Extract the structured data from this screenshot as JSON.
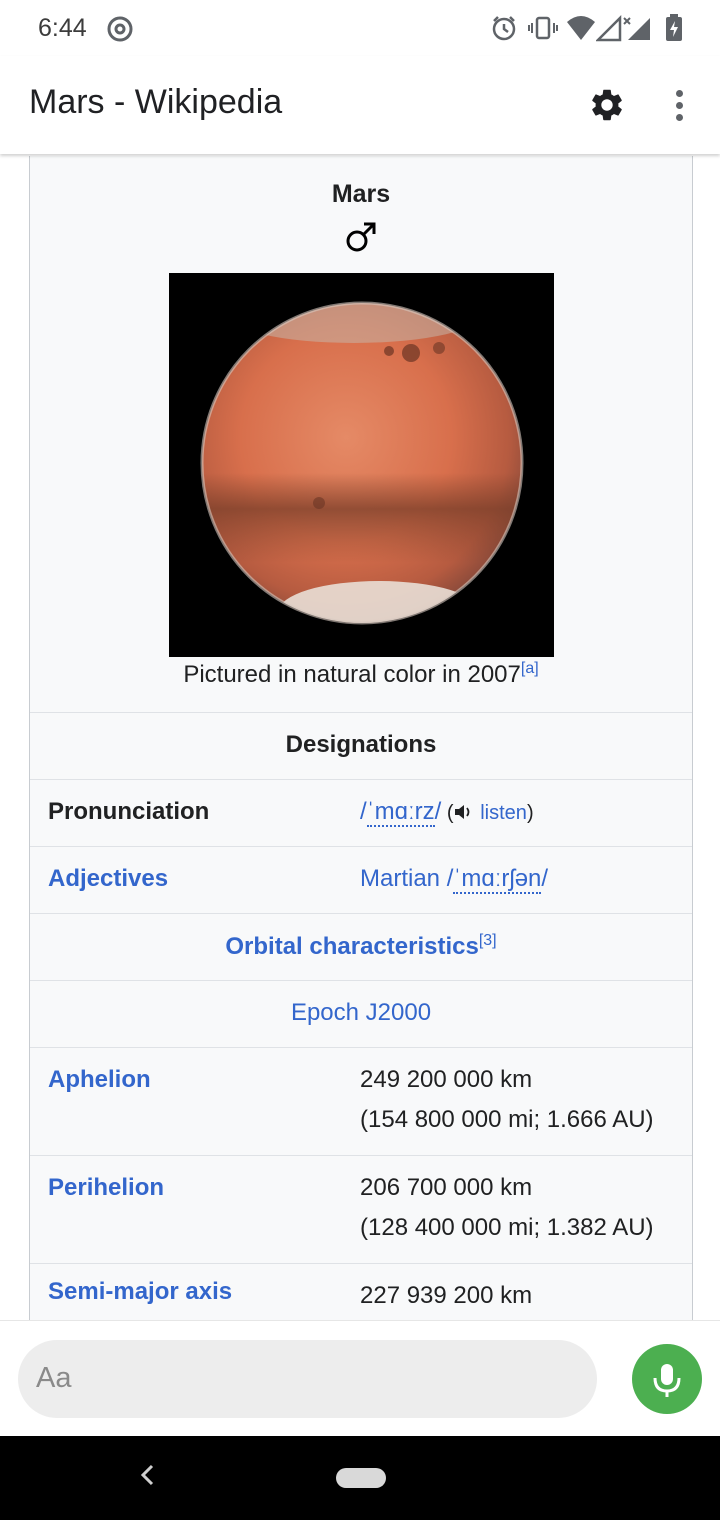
{
  "status_bar": {
    "time": "6:44"
  },
  "app_bar": {
    "title": "Mars - Wikipedia"
  },
  "infobox": {
    "name": "Mars",
    "symbol": "♂",
    "caption": "Pictured in natural color in 2007",
    "caption_ref": "[a]",
    "designations_header": "Designations",
    "pronunciation": {
      "label": "Pronunciation",
      "ipa_open": "/",
      "ipa": "ˈmɑːrz",
      "ipa_close": "/",
      "listen_open": " (",
      "listen": "listen",
      "listen_close": ")"
    },
    "adjectives": {
      "label": "Adjectives",
      "value": "Martian",
      "ipa_open": " /",
      "ipa": "ˈmɑːrʃən",
      "ipa_close": "/"
    },
    "orbital_header": "Orbital characteristics",
    "orbital_ref": "[3]",
    "epoch": "Epoch J2000",
    "aphelion": {
      "label": "Aphelion",
      "line1": "249 200 000 km",
      "line2": "(154 800 000 mi; 1.666 AU)"
    },
    "perihelion": {
      "label": "Perihelion",
      "line1": "206 700 000 km",
      "line2": "(128 400 000 mi; 1.382 AU)"
    },
    "semi_major_axis": {
      "label": "Semi-major axis",
      "line1": "227 939 200 km"
    }
  },
  "input_bar": {
    "placeholder": "Aa"
  },
  "colors": {
    "link": "#3366cc",
    "mic": "#4caf50",
    "infobox_bg": "#f8f9fa"
  },
  "icons": [
    "at-sign-icon",
    "alarm-icon",
    "vibrate-icon",
    "wifi-icon",
    "signal-icon",
    "battery-icon",
    "gear-icon",
    "more-vert-icon",
    "speaker-icon",
    "mic-icon",
    "back-icon",
    "home-pill-icon"
  ]
}
